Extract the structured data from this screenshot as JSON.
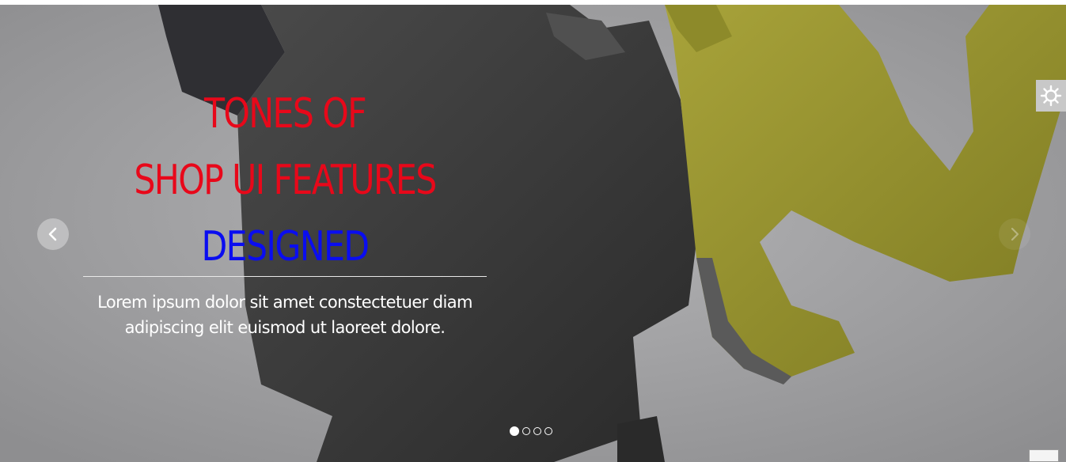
{
  "hero": {
    "headline": {
      "line1": "TONES OF",
      "line2": "SHOP UI FEATURES",
      "line3": "DESIGNED"
    },
    "description": "Lorem ipsum dolor sit amet constectetuer diam adipiscing elit euismod ut laoreet dolore.",
    "colors": {
      "primary_headline": "#e8081a",
      "accent_headline": "#0a0df0",
      "description": "#ffffff"
    }
  },
  "controls": {
    "prev_icon": "chevron-left-icon",
    "next_icon": "chevron-right-icon",
    "settings_icon": "gear-icon"
  },
  "pagination": {
    "total": 4,
    "active_index": 0
  }
}
